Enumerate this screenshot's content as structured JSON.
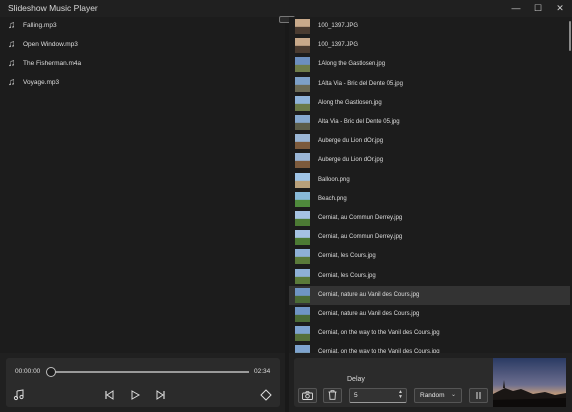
{
  "window": {
    "title": "Slideshow Music Player",
    "minimize": "—",
    "maximize": "☐",
    "close": "✕"
  },
  "music_files": [
    {
      "name": "Falling.mp3"
    },
    {
      "name": "Open Window.mp3"
    },
    {
      "name": "The Fisherman.m4a"
    },
    {
      "name": "Voyage.mp3"
    }
  ],
  "images": [
    {
      "name": "100_1397.JPG",
      "colors": [
        "#c8a98a",
        "#4a3b30"
      ]
    },
    {
      "name": "100_1397.JPG",
      "colors": [
        "#c8a98a",
        "#4a3b30"
      ]
    },
    {
      "name": "1Along the Gastlosen.jpg",
      "colors": [
        "#6c8fbf",
        "#6f7d4a"
      ]
    },
    {
      "name": "1Alta Via - Bric del Dente 05.jpg",
      "colors": [
        "#7da0c8",
        "#6b6a55"
      ]
    },
    {
      "name": "Along the Gastlosen.jpg",
      "colors": [
        "#8fb3d9",
        "#6b7a48"
      ]
    },
    {
      "name": "Alta Via - Bric del Dente 05.jpg",
      "colors": [
        "#86a9cf",
        "#5c5d49"
      ]
    },
    {
      "name": "Auberge du Lion dOr.jpg",
      "colors": [
        "#9ab6d6",
        "#7c5a3c"
      ]
    },
    {
      "name": "Auberge du Lion dOr.jpg",
      "colors": [
        "#9ab6d6",
        "#7c5a3c"
      ]
    },
    {
      "name": "Balloon.png",
      "colors": [
        "#9fc4e6",
        "#b8a07a"
      ]
    },
    {
      "name": "Beach.png",
      "colors": [
        "#88b9d8",
        "#4f8a3c"
      ]
    },
    {
      "name": "Cerniat, au Commun Derrey.jpg",
      "colors": [
        "#a5c2e2",
        "#4c7a34"
      ]
    },
    {
      "name": "Cerniat, au Commun Derrey.jpg",
      "colors": [
        "#a5c2e2",
        "#4c7a34"
      ]
    },
    {
      "name": "Cerniat, les Cours.jpg",
      "colors": [
        "#8eb0d6",
        "#5a7a3a"
      ]
    },
    {
      "name": "Cerniat, les Cours.jpg",
      "colors": [
        "#8eb0d6",
        "#5a7a3a"
      ]
    },
    {
      "name": "Cerniat, nature au Vanil des Cours.jpg",
      "colors": [
        "#6f95c4",
        "#4b6b36"
      ]
    },
    {
      "name": "Cerniat, nature au Vanil des Cours.jpg",
      "colors": [
        "#6f95c4",
        "#4b6b36"
      ]
    },
    {
      "name": "Cerniat, on the way to the Vanil des Cours.jpg",
      "colors": [
        "#7ea3cf",
        "#56703a"
      ]
    },
    {
      "name": "Cerniat, on the way to the Vanil des Cours.jpg",
      "colors": [
        "#7ea3cf",
        "#56703a"
      ]
    }
  ],
  "selected_image_index": 14,
  "player": {
    "current_time": "00:00:00",
    "total_time": "02:34",
    "progress": 0
  },
  "slideshow": {
    "delay_label": "Delay",
    "delay_value": "5",
    "mode": "Random"
  },
  "icons": {
    "music_file": "music-note-icon",
    "add_music": "music-note-icon",
    "previous": "skip-previous-icon",
    "play": "play-icon",
    "next": "skip-next-icon",
    "shuffle": "diamond-icon",
    "capture": "camera-icon",
    "delete": "trash-icon",
    "pause": "pause-icon"
  }
}
